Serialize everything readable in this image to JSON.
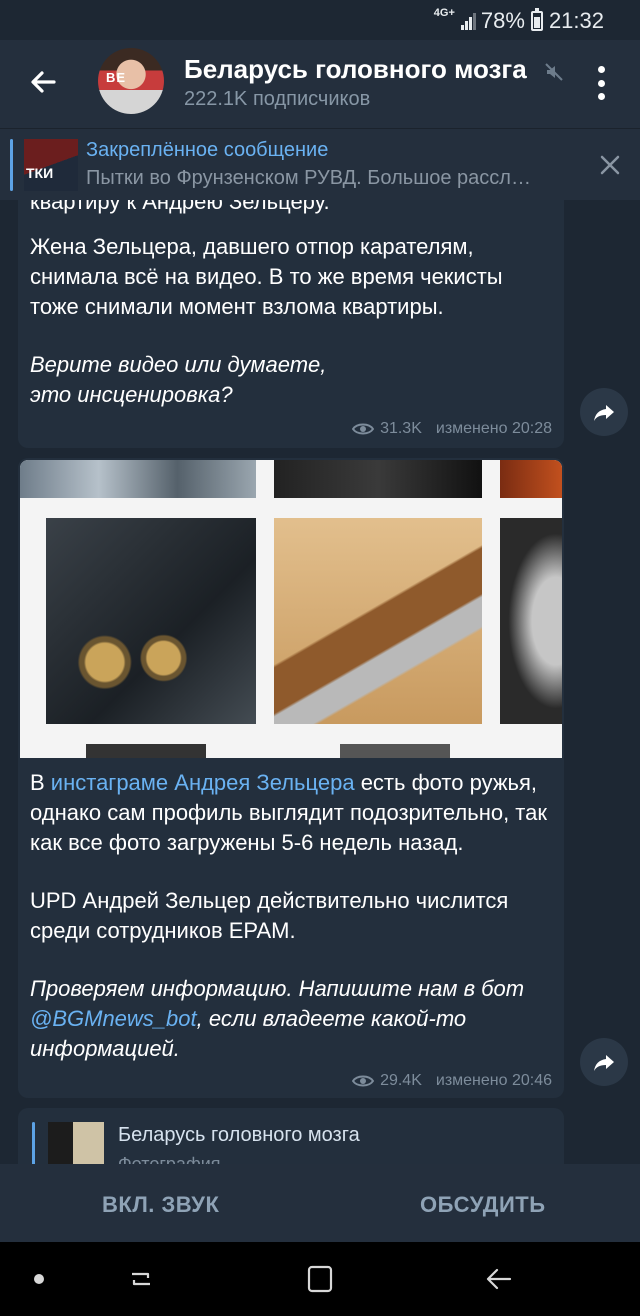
{
  "status_bar": {
    "network": "4G+",
    "battery": "78%",
    "time": "21:32"
  },
  "header": {
    "title": "Беларусь головного мозга",
    "subtitle": "222.1K подписчиков",
    "avatar_text": "BE\nBE",
    "back_icon": "arrow-left-icon",
    "mute_icon": "muted-speaker-icon",
    "menu_icon": "more-vert-icon"
  },
  "pinned": {
    "title": "Закреплённое сообщение",
    "text": "Пытки во Фрунзенском РУВД. Большое рассл…",
    "thumb_text": "ТКИ"
  },
  "messages": [
    {
      "partial_top": "квартиру к Андрею Зельцеру.",
      "paragraphs": [
        "Жена Зельцера, давшего отпор карателям, снимала всё на видео. В то же время чекисты тоже снимали момент взлома квартиры."
      ],
      "italic": "Верите видео или думаете, это инсценировка?",
      "views": "31.3K",
      "edited": "изменено 20:28"
    },
    {
      "text_before_link": "В ",
      "link": "инстаграме Андрея Зельцера",
      "text_after_link": " есть фото ружья, однако сам профиль выглядит подозрительно, так как все фото загружены 5-6 недель назад.",
      "upd": "UPD Андрей Зельцер действительно числится среди сотрудников EPAM.",
      "italic_before": "Проверяем информацию. Напишите нам в бот ",
      "bot_link": "@BGMnews_bot",
      "italic_after": ", если владеете какой-то информацией.",
      "views": "29.4K",
      "edited": "изменено 20:46"
    },
    {
      "forward_title": "Беларусь головного мозга",
      "forward_subtitle": "Фотография"
    }
  ],
  "action_bar": {
    "mute_label": "ВКЛ. ЗВУК",
    "discuss_label": "ОБСУДИТЬ"
  },
  "colors": {
    "background": "#1d2733",
    "header": "#242f3d",
    "bubble": "#232f3d",
    "link": "#6ab2f2",
    "muted_text": "#7d8c9b"
  }
}
